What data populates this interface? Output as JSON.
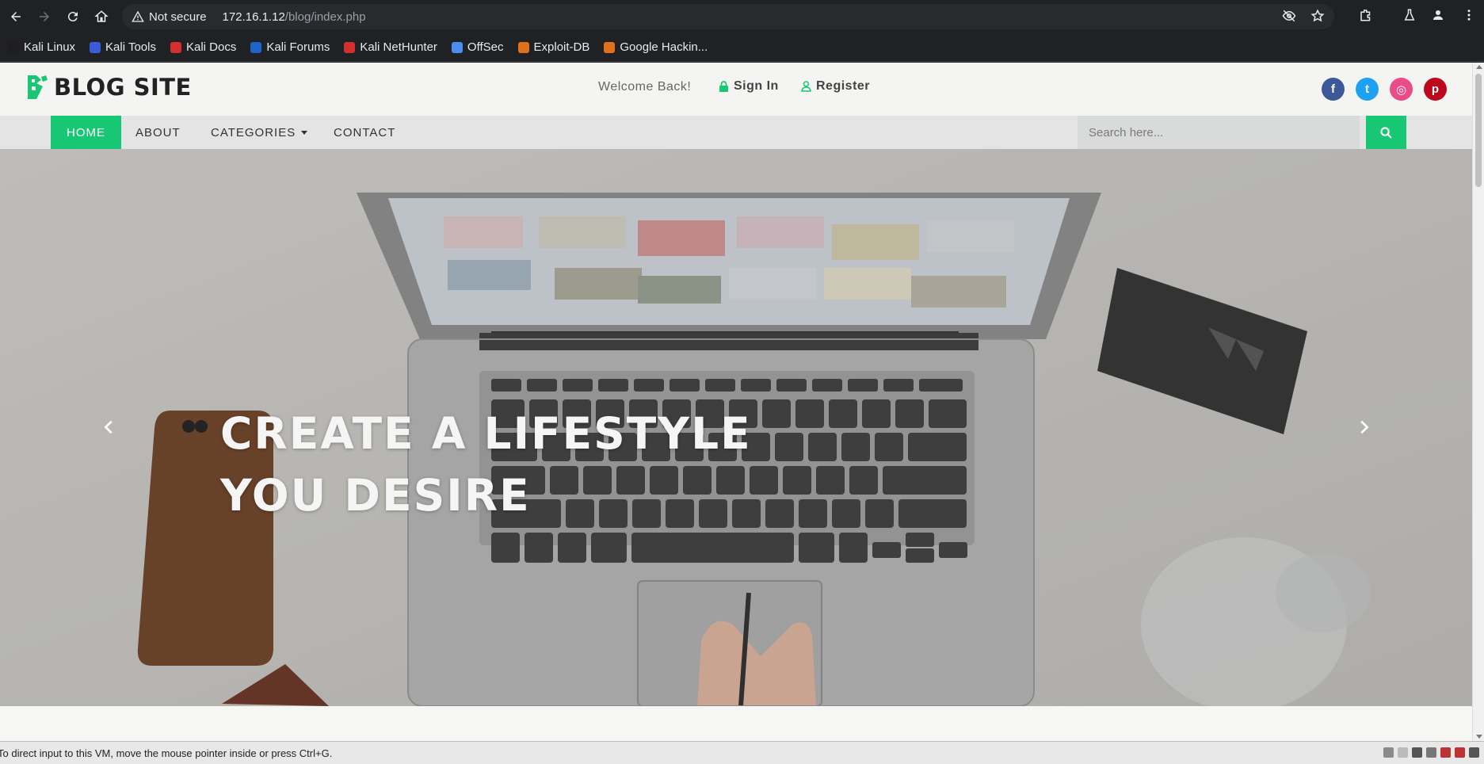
{
  "browser": {
    "security_label": "Not secure",
    "url_host": "172.16.1.12",
    "url_path": "/blog/index.php",
    "bookmarks": [
      {
        "label": "Kali Linux",
        "color": "#1e1e1e"
      },
      {
        "label": "Kali Tools",
        "color": "#3b5bdb"
      },
      {
        "label": "Kali Docs",
        "color": "#d32f2f"
      },
      {
        "label": "Kali Forums",
        "color": "#1e63c7"
      },
      {
        "label": "Kali NetHunter",
        "color": "#d32f2f"
      },
      {
        "label": "OffSec",
        "color": "#4a8ef0"
      },
      {
        "label": "Exploit-DB",
        "color": "#e0701a"
      },
      {
        "label": "Google Hackin...",
        "color": "#e0701a"
      }
    ]
  },
  "site": {
    "logo_text": "BLOG SITE",
    "welcome": "Welcome Back!",
    "sign_in": "Sign In",
    "register": "Register",
    "socials": [
      {
        "icon": "facebook-icon",
        "glyph": "f",
        "color": "#3b5998"
      },
      {
        "icon": "twitter-icon",
        "glyph": "t",
        "color": "#1da1f2"
      },
      {
        "icon": "dribbble-icon",
        "glyph": "◎",
        "color": "#ea4c89"
      },
      {
        "icon": "pinterest-icon",
        "glyph": "p",
        "color": "#bd081c"
      }
    ],
    "accent_color": "#17c774"
  },
  "nav": {
    "home": "HOME",
    "about": "ABOUT",
    "categories": "CATEGORIES",
    "contact": "CONTACT",
    "search_placeholder": "Search here..."
  },
  "hero": {
    "line1": "CREATE A LIFESTYLE",
    "line2": "YOU DESIRE"
  },
  "statusbar": {
    "text": "To direct input to this VM, move the mouse pointer inside or press Ctrl+G."
  }
}
